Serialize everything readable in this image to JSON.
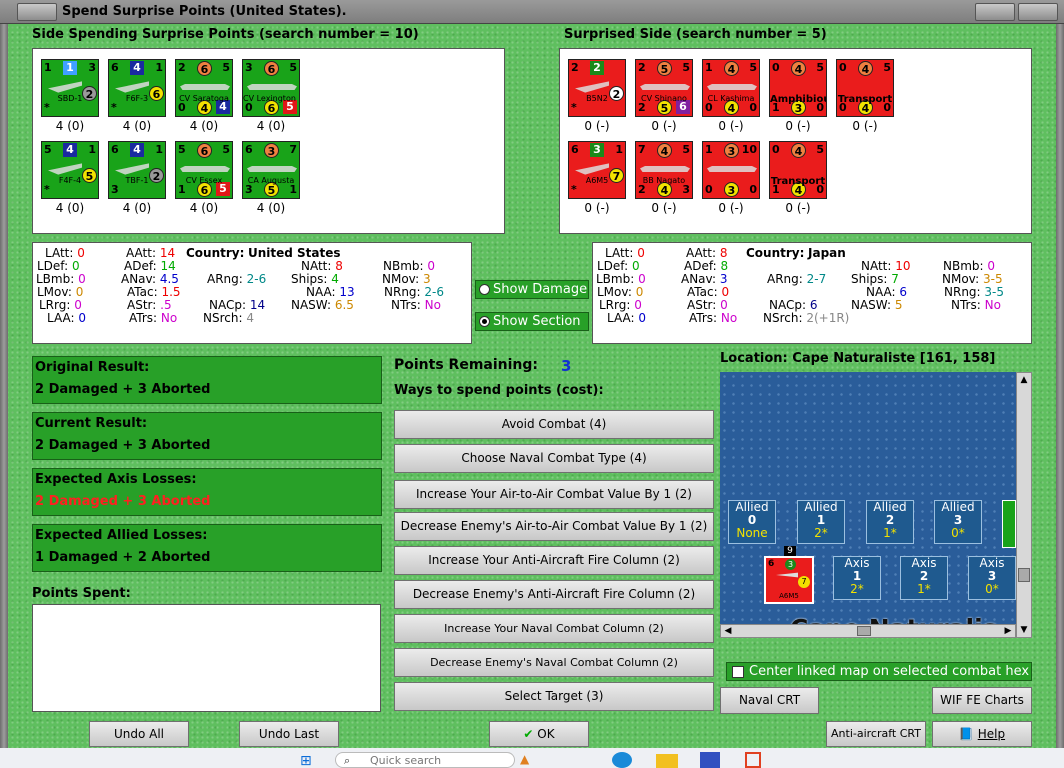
{
  "window": {
    "title": "Spend Surprise Points (United States)."
  },
  "left_side": {
    "header": "Side Spending Surprise Points (search number = 10)",
    "units": [
      {
        "name": "SBD-1",
        "tl": "1",
        "tr": "3",
        "top": "1",
        "bl": "*",
        "br": "",
        "mid": "2",
        "cap": "4 (0)",
        "kind": "air"
      },
      {
        "name": "F6F-3",
        "tl": "6",
        "tr": "1",
        "top": "4",
        "bl": "*",
        "br": "",
        "mid": "6",
        "cap": "4 (0)",
        "kind": "air"
      },
      {
        "name": "CV Saratoga",
        "tl": "2",
        "tr": "5",
        "top": "6",
        "bl": "0",
        "br": "4",
        "mid": "4",
        "cap": "4 (0)",
        "kind": "ship"
      },
      {
        "name": "CV Lexington II",
        "tl": "3",
        "tr": "5",
        "top": "6",
        "bl": "0",
        "br": "5",
        "mid": "6",
        "cap": "4 (0)",
        "kind": "ship"
      },
      {
        "name": "F4F-4",
        "tl": "5",
        "tr": "1",
        "top": "4",
        "bl": "*",
        "br": "",
        "mid": "5",
        "cap": "4 (0)",
        "kind": "air"
      },
      {
        "name": "TBF-1",
        "tl": "6",
        "tr": "1",
        "top": "4",
        "bl": "3",
        "br": "",
        "mid": "2",
        "cap": "4 (0)",
        "kind": "air"
      },
      {
        "name": "CV Essex",
        "tl": "5",
        "tr": "5",
        "top": "6",
        "bl": "1",
        "br": "5",
        "mid": "6",
        "cap": "4 (0)",
        "kind": "ship"
      },
      {
        "name": "CA Augusta",
        "tl": "6",
        "tr": "7",
        "top": "3",
        "bl": "3",
        "br": "1",
        "mid": "5",
        "cap": "4 (0)",
        "kind": "ship"
      }
    ],
    "stats": {
      "country_label": "Country:",
      "country": "United States",
      "LAtt": "0",
      "LDef": "0",
      "LBmb": "0",
      "LMov": "0",
      "LRrg": "0",
      "LAA": "0",
      "AAtt": "14",
      "ADef": "14",
      "ANav": "4.5",
      "ATac": "1.5",
      "AStr": ".5",
      "ATrs": "No",
      "ARng": "2-6",
      "NACp": "14",
      "NSrch": "4",
      "NAtt": "8",
      "Ships": "4",
      "NAA": "13",
      "NASW": "6.5",
      "NBmb": "0",
      "NMov": "3",
      "NRng": "2-6",
      "NTrs": "No"
    }
  },
  "right_side": {
    "header": "Surprised Side (search number = 5)",
    "units": [
      {
        "name": "B5N2",
        "tl": "2",
        "tr": "",
        "top": "2",
        "bl": "*",
        "br": "",
        "mid": "2",
        "cap": "0 (-)",
        "kind": "air"
      },
      {
        "name": "CV Shinano",
        "tl": "2",
        "tr": "5",
        "top": "5",
        "bl": "2",
        "br": "6",
        "mid": "5",
        "cap": "0 (-)",
        "kind": "ship"
      },
      {
        "name": "CL Kashima",
        "tl": "1",
        "tr": "5",
        "top": "4",
        "bl": "0",
        "br": "0",
        "mid": "4",
        "cap": "0 (-)",
        "kind": "ship"
      },
      {
        "name": "Amphibious",
        "tl": "0",
        "tr": "5",
        "top": "4",
        "bl": "1",
        "br": "0",
        "mid": "3",
        "cap": "0 (-)",
        "kind": "transport"
      },
      {
        "name": "Transport",
        "tl": "0",
        "tr": "5",
        "top": "4",
        "bl": "0",
        "br": "0",
        "mid": "4",
        "cap": "0 (-)",
        "kind": "transport"
      },
      {
        "name": "A6M5",
        "tl": "6",
        "tr": "1",
        "top": "3",
        "bl": "*",
        "br": "",
        "mid": "7",
        "cap": "0 (-)",
        "kind": "air"
      },
      {
        "name": "BB Nagato",
        "tl": "7",
        "tr": "5",
        "top": "4",
        "bl": "2",
        "br": "3",
        "mid": "4",
        "cap": "0 (-)",
        "kind": "ship"
      },
      {
        "name": "",
        "tl": "1",
        "tr": "10",
        "top": "3",
        "bl": "0",
        "br": "0",
        "mid": "3",
        "cap": "0 (-)",
        "kind": "ship"
      },
      {
        "name": "Transport",
        "tl": "0",
        "tr": "5",
        "top": "4",
        "bl": "1",
        "br": "0",
        "mid": "4",
        "cap": "0 (-)",
        "kind": "transport"
      }
    ],
    "stats": {
      "country_label": "Country:",
      "country": "Japan",
      "LAtt": "0",
      "LDef": "0",
      "LBmb": "0",
      "LMov": "0",
      "LRrg": "0",
      "LAA": "0",
      "AAtt": "8",
      "ADef": "8",
      "ANav": "3",
      "ATac": "0",
      "AStr": "0",
      "ATrs": "No",
      "ARng": "2-7",
      "NACp": "6",
      "NSrch": "2(+1R)",
      "NAtt": "10",
      "Ships": "7",
      "NAA": "6",
      "NASW": "5",
      "NBmb": "0",
      "NMov": "3-5",
      "NRng": "3-5",
      "NTrs": "No"
    }
  },
  "toggles": {
    "show_damage": "Show Damage",
    "show_section": "Show Section",
    "selected": "Show Section"
  },
  "results": {
    "original": {
      "label": "Original Result:",
      "value": "2 Damaged + 3 Aborted"
    },
    "current": {
      "label": "Current Result:",
      "value": "2 Damaged + 3 Aborted"
    },
    "axis": {
      "label": "Expected Axis Losses:",
      "value": "2 Damaged + 3 Aborted"
    },
    "allied": {
      "label": "Expected Allied Losses:",
      "value": "1 Damaged + 2 Aborted"
    }
  },
  "points": {
    "remaining_label": "Points Remaining:",
    "remaining": "3",
    "ways_label": "Ways to spend points (cost):",
    "spent_label": "Points Spent:",
    "options": [
      "Avoid Combat (4)",
      "Choose Naval Combat Type (4)",
      "Increase Your Air-to-Air Combat Value By 1 (2)",
      "Decrease Enemy's Air-to-Air Combat Value By 1 (2)",
      "Increase Your Anti-Aircraft Fire Column (2)",
      "Decrease Enemy's Anti-Aircraft Fire Column (2)",
      "Increase Your Naval Combat Column (2)",
      "Decrease Enemy's Naval Combat Column (2)",
      "Select Target (3)"
    ]
  },
  "location": {
    "label": "Location: Cape Naturaliste [161, 158]",
    "map_name": "Cape Naturalis",
    "allied_boxes": [
      {
        "title": "Allied",
        "num": "0",
        "sub": "None"
      },
      {
        "title": "Allied",
        "num": "1",
        "sub": "2*"
      },
      {
        "title": "Allied",
        "num": "2",
        "sub": "1*"
      },
      {
        "title": "Allied",
        "num": "3",
        "sub": "0*"
      }
    ],
    "axis_boxes": [
      {
        "title": "Axis",
        "num": "1",
        "sub": "2*"
      },
      {
        "title": "Axis",
        "num": "2",
        "sub": "1*"
      },
      {
        "title": "Axis",
        "num": "3",
        "sub": "0*"
      }
    ],
    "stack_count": "9",
    "map_unit": {
      "name": "A6M5",
      "tl": "6",
      "top": "3",
      "mid": "7"
    },
    "center_label": "Center linked map on selected combat hex"
  },
  "buttons": {
    "undo_all": "Undo All",
    "undo_last": "Undo Last",
    "ok": "OK",
    "naval_crt": "Naval CRT",
    "wif_charts": "WIF FE Charts",
    "aa_crt": "Anti-aircraft CRT",
    "help": "Help"
  },
  "taskbar": {
    "search_placeholder": "Quick search"
  },
  "colors": {
    "allied_green": "#19a319",
    "axis_red": "#ea1c1c",
    "panel_green": "#28a028",
    "loss_red": "#ff2020"
  }
}
